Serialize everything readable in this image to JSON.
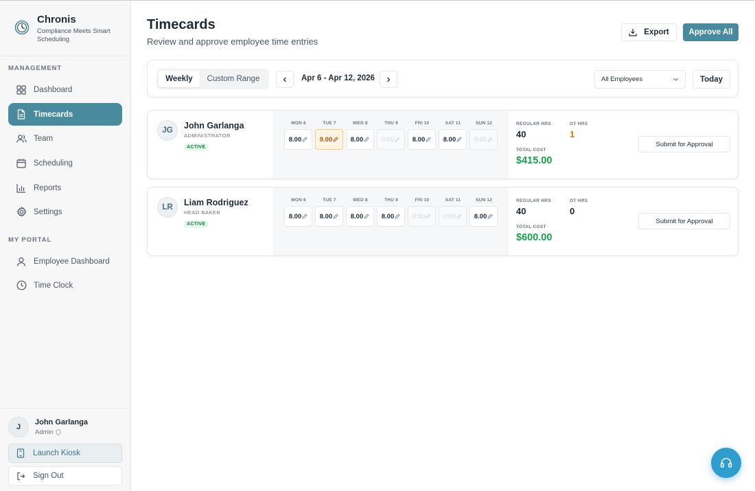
{
  "brand": {
    "name": "Chronis",
    "tagline": "Compliance Meets Smart Scheduling"
  },
  "sidebar": {
    "management_label": "MANAGEMENT",
    "portal_label": "MY PORTAL",
    "items": [
      {
        "label": "Dashboard",
        "icon": "dashboard-icon"
      },
      {
        "label": "Timecards",
        "icon": "document-icon",
        "active": true
      },
      {
        "label": "Team",
        "icon": "users-icon"
      },
      {
        "label": "Scheduling",
        "icon": "calendar-icon"
      },
      {
        "label": "Reports",
        "icon": "bar-chart-icon"
      },
      {
        "label": "Settings",
        "icon": "gear-icon"
      }
    ],
    "portal_items": [
      {
        "label": "Employee Dashboard",
        "icon": "user-icon"
      },
      {
        "label": "Time Clock",
        "icon": "clock-icon"
      }
    ],
    "user": {
      "initial": "J",
      "name": "John Garlanga",
      "role": "Admin"
    },
    "launch_kiosk": "Launch Kiosk",
    "sign_out": "Sign Out"
  },
  "header": {
    "title": "Timecards",
    "subtitle": "Review and approve employee time entries",
    "export_label": "Export",
    "approve_all_label": "Approve All"
  },
  "toolbar": {
    "weekly": "Weekly",
    "custom_range": "Custom Range",
    "date_range": "Apr 6 - Apr 12, 2026",
    "employee_filter": "All Employees",
    "today": "Today"
  },
  "labels": {
    "regular_hrs": "REGULAR HRS",
    "ot_hrs": "OT HRS",
    "total_cost": "TOTAL COST",
    "submit": "Submit for Approval"
  },
  "days": [
    "MON 6",
    "TUE 7",
    "WED 8",
    "THU 9",
    "FRI 10",
    "SAT 11",
    "SUN 12"
  ],
  "employees": [
    {
      "initials": "JG",
      "name": "John Garlanga",
      "title": "ADMINISTRATOR",
      "status": "ACTIVE",
      "hours": [
        "8.00",
        "9.00",
        "8.00",
        "0:00",
        "8.00",
        "8.00",
        "0:00"
      ],
      "regular_hrs": "40",
      "ot_hrs": "1",
      "total_cost": "$415.00"
    },
    {
      "initials": "LR",
      "name": "Liam Rodriguez",
      "title": "HEAD BAKER",
      "status": "ACTIVE",
      "hours": [
        "8.00",
        "8.00",
        "8.00",
        "8.00",
        "0:00",
        "0:00",
        "8.00"
      ],
      "regular_hrs": "40",
      "ot_hrs": "0",
      "total_cost": "$600.00"
    }
  ],
  "colors": {
    "accent": "#4a8a9e",
    "cost": "#16a34a",
    "overtime": "#d97706",
    "fab": "#2f9ecf"
  }
}
